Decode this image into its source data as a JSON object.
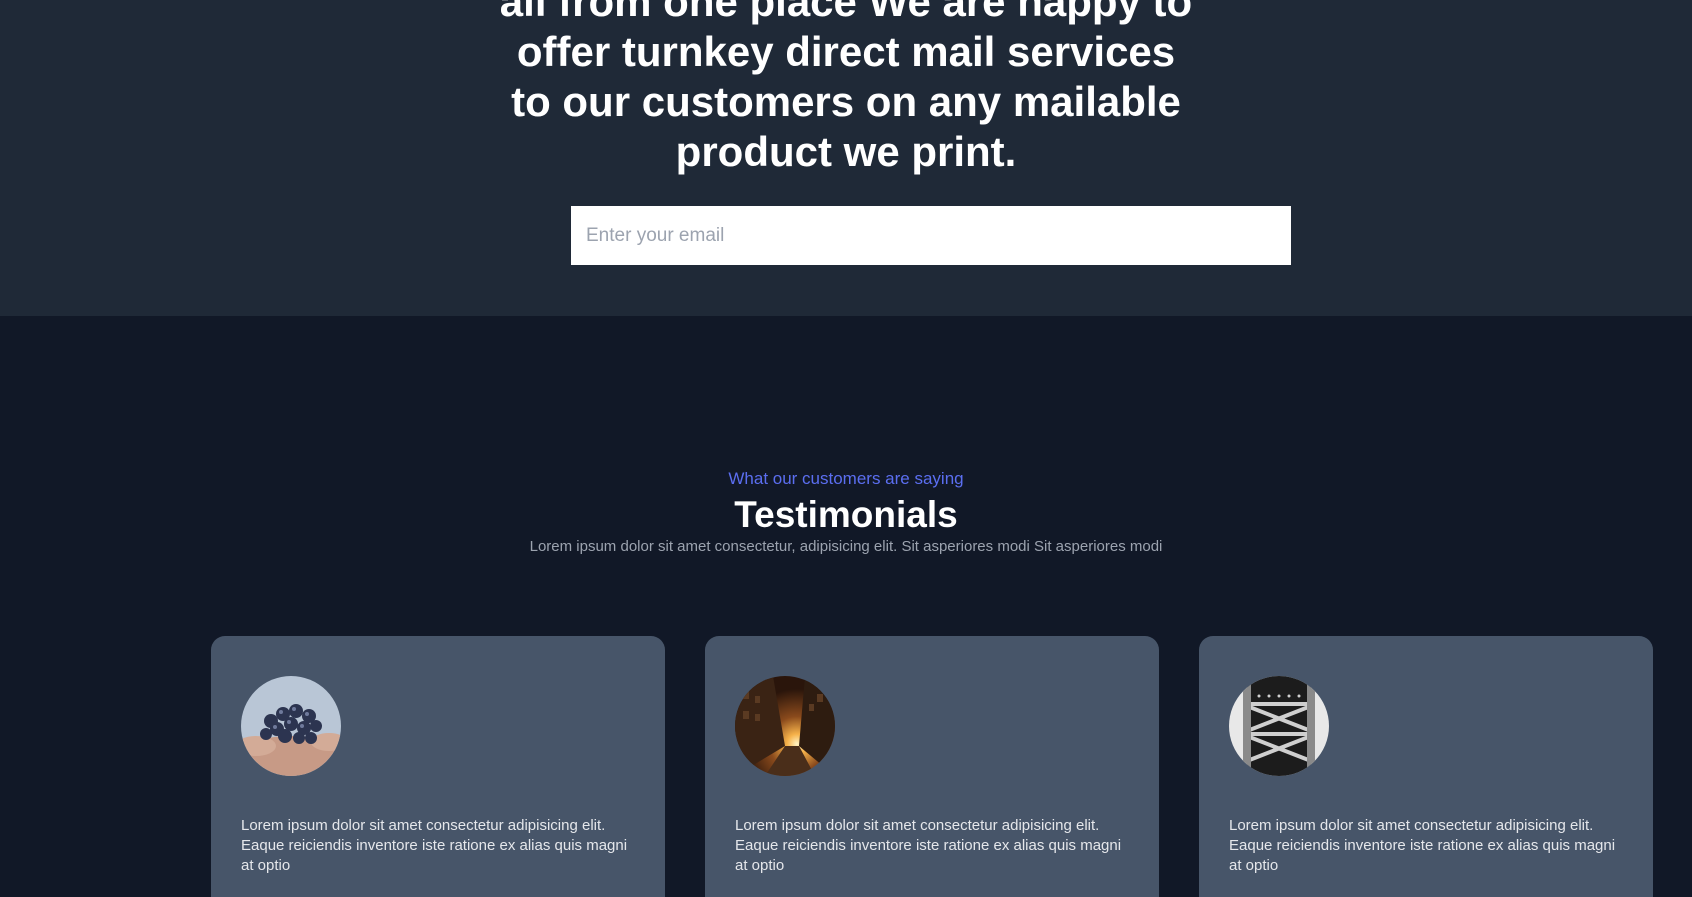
{
  "hero": {
    "lines": [
      "all from one place We are happy to",
      "offer turnkey direct mail services",
      "to our customers on any mailable",
      "product we print."
    ],
    "email_placeholder": "Enter your email"
  },
  "testimonials": {
    "eyebrow": "What our customers are saying",
    "title": "Testimonials",
    "subtitle": "Lorem ipsum dolor sit amet consectetur, adipisicing elit. Sit asperiores modi Sit asperiores modi",
    "cards": [
      {
        "avatar_icon": "blueberries-photo-icon",
        "quote": "Lorem ipsum dolor sit amet consectetur adipisicing elit. Eaque reiciendis inventore iste ratione ex alias quis magni at optio"
      },
      {
        "avatar_icon": "sunset-street-photo-icon",
        "quote": "Lorem ipsum dolor sit amet consectetur adipisicing elit. Eaque reiciendis inventore iste ratione ex alias quis magni at optio"
      },
      {
        "avatar_icon": "steel-structure-photo-icon",
        "quote": "Lorem ipsum dolor sit amet consectetur adipisicing elit. Eaque reiciendis inventore iste ratione ex alias quis magni at optio"
      }
    ]
  },
  "colors": {
    "hero_bg": "#1f2937",
    "section_bg": "#111827",
    "card_bg": "#475569",
    "accent": "#5b6ef0"
  }
}
